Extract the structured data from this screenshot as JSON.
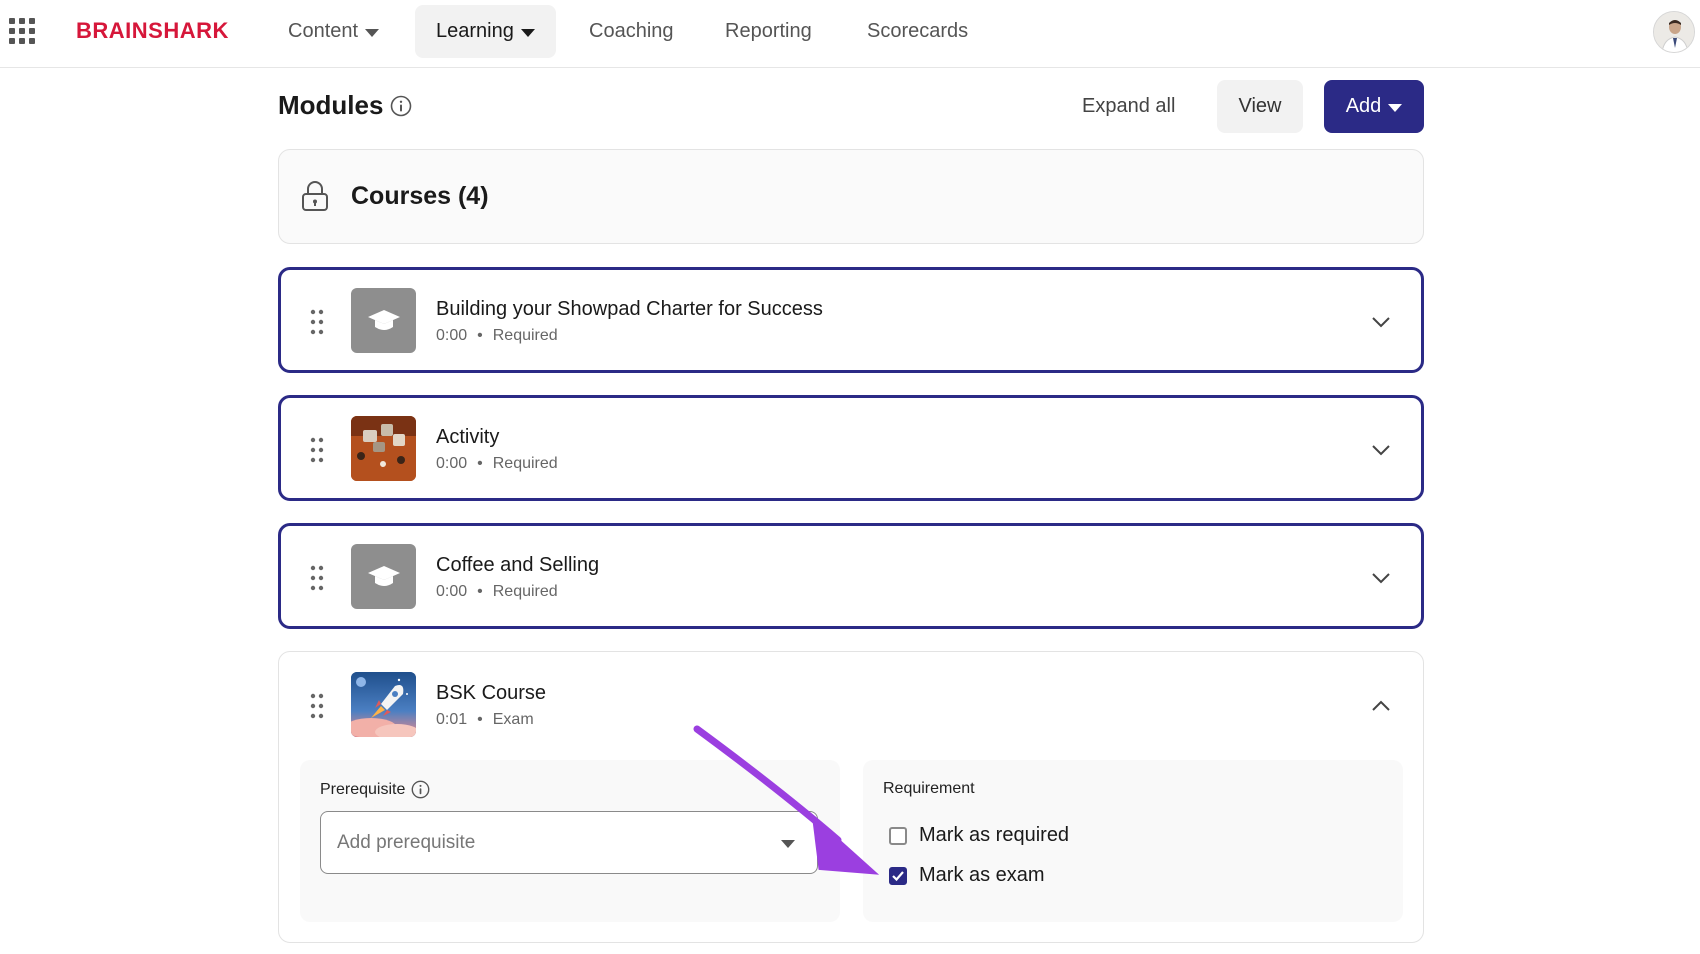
{
  "nav": {
    "logo": "BRAINSHARK",
    "items": [
      {
        "label": "Content",
        "has_caret": true,
        "active": false
      },
      {
        "label": "Learning",
        "has_caret": true,
        "active": true
      },
      {
        "label": "Coaching",
        "has_caret": false,
        "active": false
      },
      {
        "label": "Reporting",
        "has_caret": false,
        "active": false
      },
      {
        "label": "Scorecards",
        "has_caret": false,
        "active": false
      }
    ],
    "brand_color": "#d6173a",
    "icons": {
      "apps": "grid-apps-icon",
      "avatar": "user-avatar"
    }
  },
  "modules": {
    "title": "Modules",
    "expand_all_label": "Expand all",
    "view_label": "View",
    "add_label": "Add",
    "accent_color": "#2b2a86"
  },
  "group": {
    "title": "Courses (4)",
    "icon": "lock-icon"
  },
  "courses": [
    {
      "title": "Building your Showpad Charter for Success",
      "duration": "0:00",
      "status": "Required",
      "thumbnail": "graduation-cap",
      "expanded": false
    },
    {
      "title": "Activity",
      "duration": "0:00",
      "status": "Required",
      "thumbnail": "photo",
      "expanded": false
    },
    {
      "title": "Coffee and Selling",
      "duration": "0:00",
      "status": "Required",
      "thumbnail": "graduation-cap",
      "expanded": false
    },
    {
      "title": "BSK Course",
      "duration": "0:01",
      "status": "Exam",
      "thumbnail": "rocket",
      "expanded": true
    }
  ],
  "expanded_panel": {
    "prerequisite_label": "Prerequisite",
    "prerequisite_placeholder": "Add prerequisite",
    "requirement_label": "Requirement",
    "mark_required_label": "Mark as required",
    "mark_required_checked": false,
    "mark_exam_label": "Mark as exam",
    "mark_exam_checked": true
  },
  "annotation": {
    "arrow_color": "#9b3fe0"
  }
}
